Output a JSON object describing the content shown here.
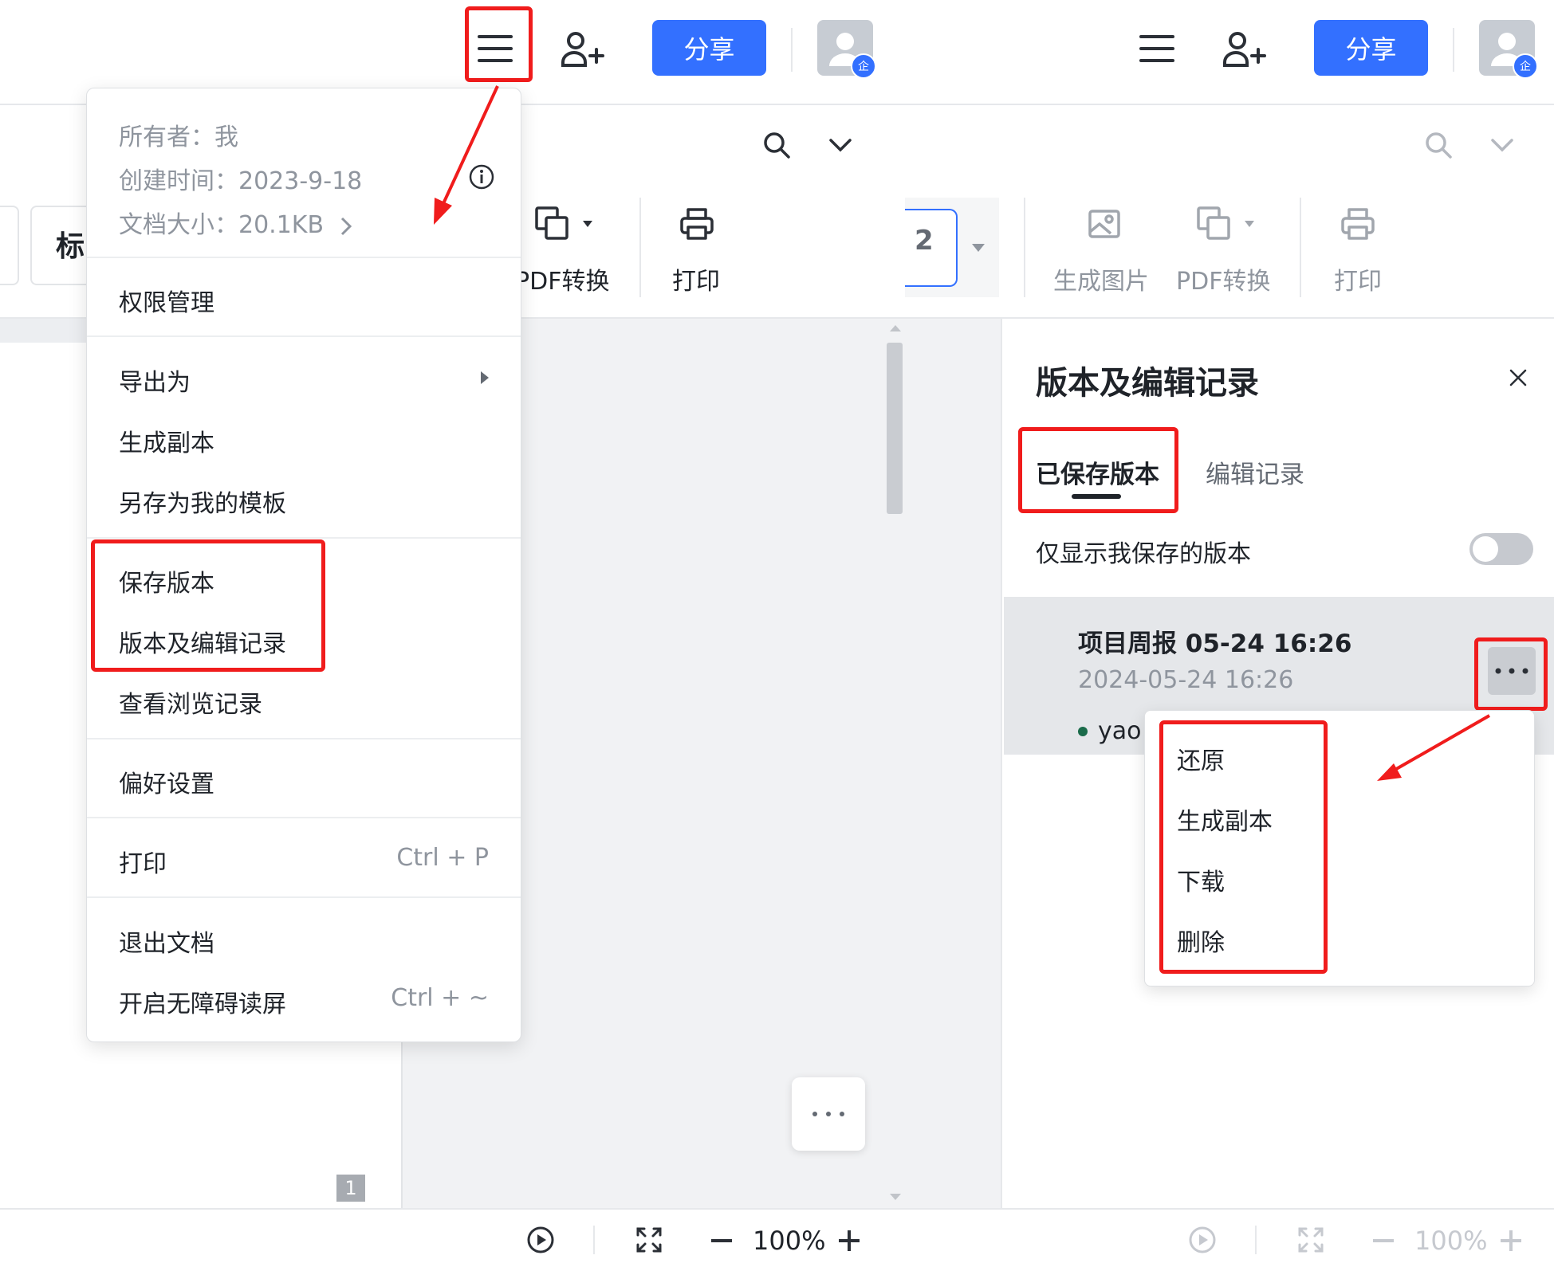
{
  "header": {
    "share_label": "分享",
    "avatar_badge": "企"
  },
  "toolbar": {
    "heading_partial": "标",
    "pdf_convert_partial": "PDF转换",
    "print_label": "打印",
    "page_number": "2",
    "right": {
      "gen_image_label": "生成图片",
      "pdf_convert_label": "PDF转换",
      "print_label": "打印"
    }
  },
  "doc_menu": {
    "owner": "所有者：我",
    "created": "创建时间：2023-9-18",
    "size": "文档大小：20.1KB",
    "items": {
      "permissions": "权限管理",
      "export_as": "导出为",
      "make_copy": "生成副本",
      "save_as_template": "另存为我的模板",
      "save_version": "保存版本",
      "version_history": "版本及编辑记录",
      "view_history": "查看浏览记录",
      "preferences": "偏好设置",
      "print": "打印",
      "print_shortcut": "Ctrl + P",
      "exit_doc": "退出文档",
      "screen_reader": "开启无障碍读屏",
      "screen_reader_shortcut": "Ctrl + ~"
    }
  },
  "version_panel": {
    "title": "版本及编辑记录",
    "tabs": [
      "已保存版本",
      "编辑记录"
    ],
    "active_tab": "已保存版本",
    "only_mine_label": "仅显示我保存的版本",
    "only_mine_enabled": false,
    "versions": [
      {
        "name": "项目周报 05-24 16:26",
        "time": "2024-05-24 16:26",
        "author": "yao"
      }
    ],
    "context_menu": [
      "还原",
      "生成副本",
      "下载",
      "删除"
    ]
  },
  "page_badge": "1",
  "bottom_bar": {
    "zoom": "100%"
  },
  "colors": {
    "accent": "#3370ff",
    "annotation_red": "#f01c1c",
    "author_dot": "#1a6b4a"
  }
}
